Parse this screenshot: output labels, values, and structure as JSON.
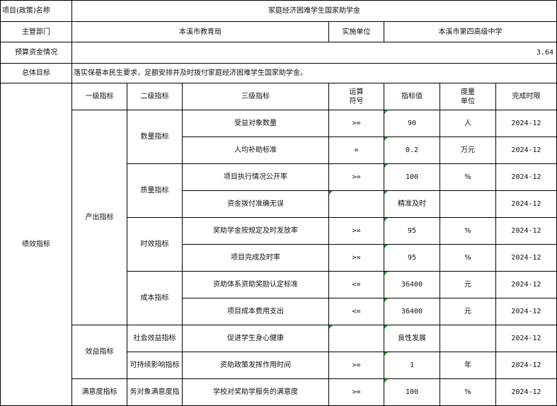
{
  "header": {
    "project_label": "项目(政策)名称",
    "project_name": "家庭经济困难学生国家助学金",
    "dept_label": "主管部门",
    "dept_value": "本溪市教育局",
    "impl_label": "实施单位",
    "impl_value": "本溪市第四高级中学",
    "budget_label": "预算资金情况",
    "budget_value": "3.64",
    "goal_label": "总体目标",
    "goal_value": "落实保基本民生要求，足额安排并及时拨付家庭经济困难学生国家助学金。"
  },
  "columns": {
    "perf_label": "绩效指标",
    "level1": "一级指标",
    "level2": "二级指标",
    "level3": "三级指标",
    "operator_line1": "运算",
    "operator_line2": "符号",
    "target": "指标值",
    "unit_line1": "度量",
    "unit_line2": "单位",
    "deadline": "完成时限"
  },
  "groups": {
    "output": "产出指标",
    "benefit": "效益指标",
    "satisfaction": "满意度指标",
    "quantity": "数量指标",
    "quality": "质量指标",
    "timeliness": "时效指标",
    "cost": "成本指标",
    "social": "社会效益指标",
    "sustain": "可持续影响指标",
    "service_satisfaction": "务对象满意度指"
  },
  "rows": [
    {
      "name": "受益对象数量",
      "op": ">=",
      "value": "90",
      "unit": "人",
      "deadline": "2024-12"
    },
    {
      "name": "人均补助标准",
      "op": "=",
      "value": "0.2",
      "unit": "万元",
      "deadline": "2024-12"
    },
    {
      "name": "项目执行情况公开率",
      "op": ">=",
      "value": "100",
      "unit": "%",
      "deadline": "2024-12"
    },
    {
      "name": "资金拨付准确无误",
      "op": "",
      "value": "精准及时",
      "unit": "",
      "deadline": "2024-12"
    },
    {
      "name": "奖助学金按规定及时发放率",
      "op": ">=",
      "value": "95",
      "unit": "%",
      "deadline": "2024-12"
    },
    {
      "name": "项目完成及时率",
      "op": ">=",
      "value": "95",
      "unit": "%",
      "deadline": "2024-12"
    },
    {
      "name": "资助体系资助奖励认定标准",
      "op": "<=",
      "value": "36400",
      "unit": "元",
      "deadline": "2024-12"
    },
    {
      "name": "项目成本费用支出",
      "op": "<=",
      "value": "36400",
      "unit": "元",
      "deadline": "2024-12"
    },
    {
      "name": "促进学生身心健康",
      "op": "",
      "value": "良性发展",
      "unit": "",
      "deadline": "2024-12"
    },
    {
      "name": "资助政策发挥作用时间",
      "op": ">=",
      "value": "1",
      "unit": "年",
      "deadline": "2024-12"
    },
    {
      "name": "学校对奖助学服务的满意度",
      "op": ">=",
      "value": "100",
      "unit": "%",
      "deadline": "2024-12"
    }
  ],
  "colors": {
    "grid": "#000000",
    "flag": "#2e9e3a"
  }
}
